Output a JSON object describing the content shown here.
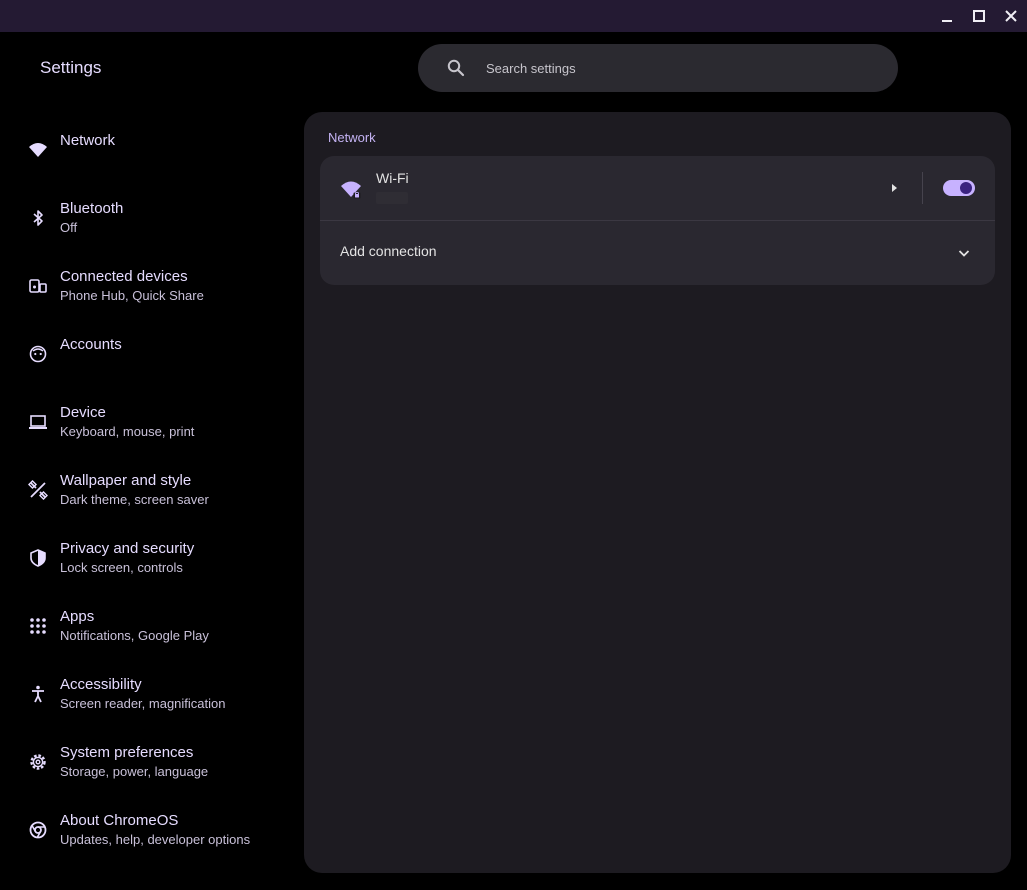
{
  "window": {
    "minimize_icon": "minimize-icon",
    "maximize_icon": "maximize-icon",
    "close_icon": "close-icon"
  },
  "app": {
    "title": "Settings"
  },
  "search": {
    "placeholder": "Search settings",
    "icon": "search-icon"
  },
  "sidebar": {
    "items": [
      {
        "label": "Network",
        "sub": "",
        "icon": "wifi-icon"
      },
      {
        "label": "Bluetooth",
        "sub": "Off",
        "icon": "bluetooth-icon"
      },
      {
        "label": "Connected devices",
        "sub": "Phone Hub, Quick Share",
        "icon": "connected-devices-icon"
      },
      {
        "label": "Accounts",
        "sub": "",
        "icon": "account-icon"
      },
      {
        "label": "Device",
        "sub": "Keyboard, mouse, print",
        "icon": "laptop-icon"
      },
      {
        "label": "Wallpaper and style",
        "sub": "Dark theme, screen saver",
        "icon": "palette-brush-icon"
      },
      {
        "label": "Privacy and security",
        "sub": "Lock screen, controls",
        "icon": "shield-icon"
      },
      {
        "label": "Apps",
        "sub": "Notifications, Google Play",
        "icon": "apps-grid-icon"
      },
      {
        "label": "Accessibility",
        "sub": "Screen reader, magnification",
        "icon": "accessibility-icon"
      },
      {
        "label": "System preferences",
        "sub": "Storage, power, language",
        "icon": "gear-icon"
      },
      {
        "label": "About ChromeOS",
        "sub": "Updates, help, developer options",
        "icon": "chrome-icon"
      }
    ]
  },
  "main": {
    "section_title": "Network",
    "wifi": {
      "label": "Wi-Fi",
      "enabled": true,
      "icon": "wifi-locked-icon",
      "arrow_icon": "arrow-right-icon"
    },
    "add_connection": {
      "label": "Add connection",
      "icon": "chevron-down-icon"
    }
  },
  "colors": {
    "titlebar": "#241a33",
    "accent": "#c7b2ff",
    "panel": "#1d1b21",
    "card": "#2a2830",
    "text_primary": "#e6dcff",
    "text_secondary": "#c9c1d9"
  }
}
